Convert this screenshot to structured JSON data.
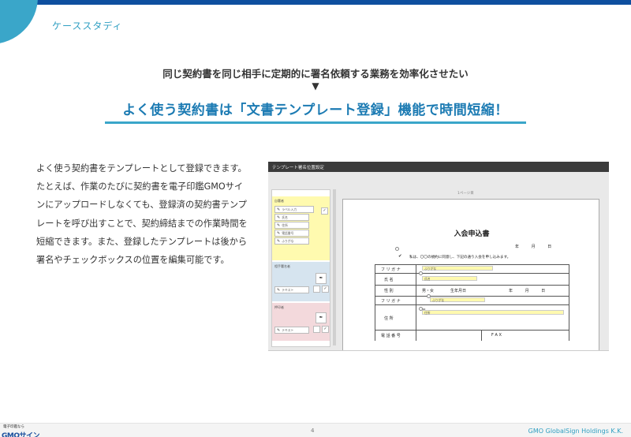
{
  "header": {
    "section": "ケーススタディ"
  },
  "title": {
    "subtitle": "同じ契約書を同じ相手に定期的に署名依頼する業務を効率化させたい",
    "arrow": "▼",
    "headline": "よく使う契約書は「文書テンプレート登録」機能で時間短縮！"
  },
  "body": {
    "text": "よく使う契約書をテンプレートとして登録できます。たとえば、作業のたびに契約書を電子印鑑GMOサインにアップロードしなくても、登録済の契約書テンプレートを呼び出すことで、契約締結までの作業時間を短縮できます。また、登録したテンプレートは後から署名やチェックボックスの位置を編集可能です。"
  },
  "screenshot": {
    "window_title": "テンプレート署名位置設定",
    "page_label": "1ページ目",
    "panel": {
      "group1_label": "自署者",
      "items": [
        "ラベル入力",
        "氏名",
        "住所",
        "電話番号",
        "ふりがな"
      ],
      "group2_label": "相手署名者",
      "group2_field": "テキスト",
      "group3_label": "押印者",
      "group3_field": "テキスト"
    },
    "doc": {
      "title": "入会申込書",
      "date": "年 月 日",
      "note": "私は、〇〇の規約に同意し、下記の通り入会を申し込みます。",
      "field_furigana": "ふりがな",
      "field_name": "氏名",
      "field_address": "住所",
      "rows": {
        "furigana1": "フ リ ガ ナ",
        "name": "氏 名",
        "gender_label": "性 別",
        "gender_value": "男・女",
        "birth_label": "生年月日",
        "birth_value": "年 月 日",
        "furigana2": "フ リ ガ ナ",
        "address": "住 所",
        "postal": "〒",
        "phone": "電 話 番 号",
        "fax": "F A X"
      }
    }
  },
  "footer": {
    "logo_small": "電子印鑑なら",
    "logo_main": "GMOサイン",
    "page_number": "4",
    "company": "GMO GlobalSign Holdings K.K."
  },
  "colors": {
    "accent": "#1c7bb3",
    "topbar": "#0e4f9f",
    "teal": "#3aa6c9"
  }
}
